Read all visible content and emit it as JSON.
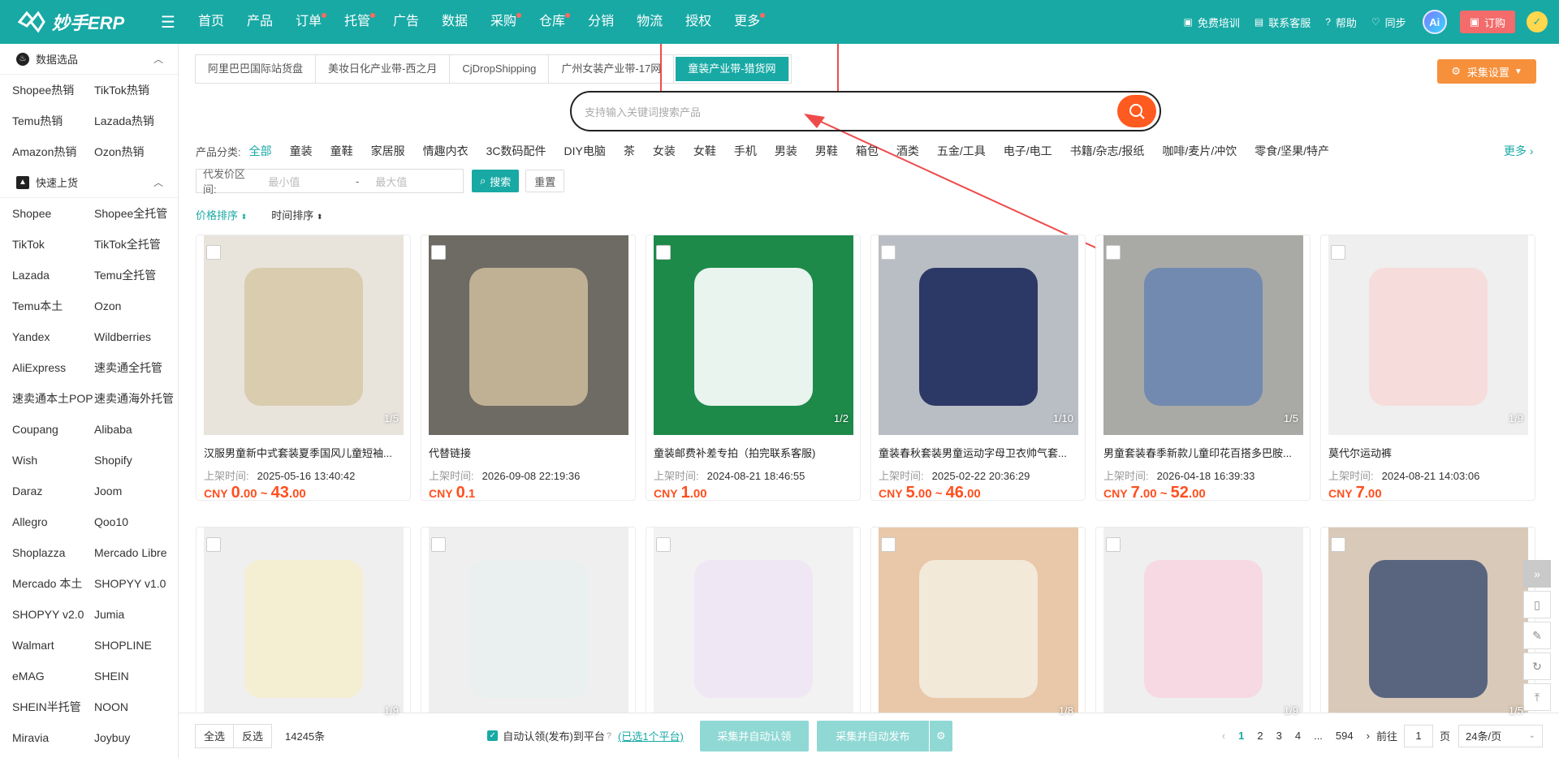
{
  "logo": {
    "text": "妙手ERP"
  },
  "nav": [
    {
      "label": "首页",
      "dot": false
    },
    {
      "label": "产品",
      "dot": false
    },
    {
      "label": "订单",
      "dot": true
    },
    {
      "label": "托管",
      "dot": true
    },
    {
      "label": "广告",
      "dot": false
    },
    {
      "label": "数据",
      "dot": false
    },
    {
      "label": "采购",
      "dot": true
    },
    {
      "label": "仓库",
      "dot": true
    },
    {
      "label": "分销",
      "dot": false
    },
    {
      "label": "物流",
      "dot": false
    },
    {
      "label": "授权",
      "dot": false
    },
    {
      "label": "更多",
      "dot": true
    }
  ],
  "right_nav": {
    "training": "免费培训",
    "contact": "联系客服",
    "help": "帮助",
    "sync": "同步",
    "ai": "Ai",
    "order": "订购"
  },
  "sidebar": {
    "sections": [
      {
        "title": "数据选品",
        "items": [
          "Shopee热销",
          "TikTok热销",
          "Temu热销",
          "Lazada热销",
          "Amazon热销",
          "Ozon热销"
        ]
      },
      {
        "title": "快速上货",
        "items": [
          "Shopee",
          "Shopee全托管",
          "TikTok",
          "TikTok全托管",
          "Lazada",
          "Temu全托管",
          "Temu本土",
          "Ozon",
          "Yandex",
          "Wildberries",
          "AliExpress",
          "速卖通全托管",
          "速卖通本土POP",
          "速卖通海外托管",
          "Coupang",
          "Alibaba",
          "Wish",
          "Shopify",
          "Daraz",
          "Joom",
          "Allegro",
          "Qoo10",
          "Shoplazza",
          "Mercado Libre",
          "Mercado 本土",
          "SHOPYY v1.0",
          "SHOPYY v2.0",
          "Jumia",
          "Walmart",
          "SHOPLINE",
          "eMAG",
          "SHEIN",
          "SHEIN半托管",
          "NOON",
          "Miravia",
          "Joybuy"
        ]
      }
    ]
  },
  "tabs": [
    "阿里巴巴国际站货盘",
    "美妆日化产业带-西之月",
    "CjDropShipping",
    "广州女装产业带-17网",
    "童装产业带-猎货网"
  ],
  "active_tab": 4,
  "collect_settings": "采集设置",
  "search": {
    "placeholder": "支持输入关键词搜索产品"
  },
  "categories": {
    "label": "产品分类:",
    "items": [
      "全部",
      "童装",
      "童鞋",
      "家居服",
      "情趣内衣",
      "3C数码配件",
      "DIY电脑",
      "茶",
      "女装",
      "女鞋",
      "手机",
      "男装",
      "男鞋",
      "箱包",
      "酒类",
      "五金/工具",
      "电子/电工",
      "书籍/杂志/报纸",
      "咖啡/麦片/冲饮",
      "零食/坚果/特产"
    ],
    "more": "更多"
  },
  "filter": {
    "label": "代发价区间:",
    "min": "最小值",
    "max": "最大值",
    "search": "搜索",
    "reset": "重置"
  },
  "sorts": [
    "价格排序",
    "时间排序"
  ],
  "time_label": "上架时间:",
  "products": [
    {
      "title": "汉服男童新中式套装夏季国风儿童短袖...",
      "time": "2025-05-16 13:40:42",
      "cur": "CNY",
      "p1": "0",
      "p1d": ".00",
      "p2": "43",
      "p2d": ".00",
      "count": "1/5",
      "bg": "#e8e4dc",
      "fg": "#d8c9a8"
    },
    {
      "title": "代替链接",
      "time": "2026-09-08 22:19:36",
      "cur": "CNY",
      "p1": "0",
      "p1d": ".1",
      "p2": "",
      "p2d": "",
      "count": "",
      "bg": "#6e6a64",
      "fg": "#c9b99a"
    },
    {
      "title": "童装邮费补差专拍（拍完联系客服)",
      "time": "2024-08-21 18:46:55",
      "cur": "CNY",
      "p1": "1",
      "p1d": ".00",
      "p2": "",
      "p2d": "",
      "count": "1/2",
      "bg": "#1d8a4a",
      "fg": "#ffffff"
    },
    {
      "title": "童装春秋套装男童运动字母卫衣帅气套...",
      "time": "2025-02-22 20:36:29",
      "cur": "CNY",
      "p1": "5",
      "p1d": ".00",
      "p2": "46",
      "p2d": ".00",
      "count": "1/10",
      "bg": "#b9bec4",
      "fg": "#1d2a5c"
    },
    {
      "title": "男童套装春季新款儿童印花百搭多巴胺...",
      "time": "2026-04-18 16:39:33",
      "cur": "CNY",
      "p1": "7",
      "p1d": ".00",
      "p2": "52",
      "p2d": ".00",
      "count": "1/5",
      "bg": "#a9a9a6",
      "fg": "#6b86b0"
    },
    {
      "title": "莫代尔运动裤",
      "time": "2024-08-21 14:03:06",
      "cur": "CNY",
      "p1": "7",
      "p1d": ".00",
      "p2": "",
      "p2d": "",
      "count": "1/9",
      "bg": "#efefef",
      "fg": "#f7d9d9"
    },
    {
      "title": "",
      "time": "",
      "cur": "",
      "p1": "",
      "p1d": "",
      "p2": "",
      "p2d": "",
      "count": "1/9",
      "bg": "#efefef",
      "fg": "#f4edcf"
    },
    {
      "title": "",
      "time": "",
      "cur": "",
      "p1": "",
      "p1d": "",
      "p2": "",
      "p2d": "",
      "count": "",
      "bg": "#efefef",
      "fg": "#e9f0f0"
    },
    {
      "title": "",
      "time": "",
      "cur": "",
      "p1": "",
      "p1d": "",
      "p2": "",
      "p2d": "",
      "count": "",
      "bg": "#f2f2f2",
      "fg": "#efe6f4"
    },
    {
      "title": "",
      "time": "",
      "cur": "",
      "p1": "",
      "p1d": "",
      "p2": "",
      "p2d": "",
      "count": "1/8",
      "bg": "#e8c8a9",
      "fg": "#f3ecde"
    },
    {
      "title": "",
      "time": "",
      "cur": "",
      "p1": "",
      "p1d": "",
      "p2": "",
      "p2d": "",
      "count": "1/9",
      "bg": "#efefef",
      "fg": "#f6d6e0"
    },
    {
      "title": "",
      "time": "",
      "cur": "",
      "p1": "",
      "p1d": "",
      "p2": "",
      "p2d": "",
      "count": "1/5",
      "bg": "#d9c9b8",
      "fg": "#4a5a78"
    }
  ],
  "bottom": {
    "select_all": "全选",
    "invert": "反选",
    "total": "14245条",
    "auto_label": "自动认领(发布)到平台",
    "selected_platforms": "(已选1个平台)",
    "collect_claim": "采集并自动认领",
    "collect_publish": "采集并自动发布"
  },
  "pager": {
    "pages": [
      "1",
      "2",
      "3",
      "4",
      "...",
      "594"
    ],
    "goto": "前往",
    "page_value": "1",
    "page_unit": "页",
    "per_page": "24条/页"
  }
}
